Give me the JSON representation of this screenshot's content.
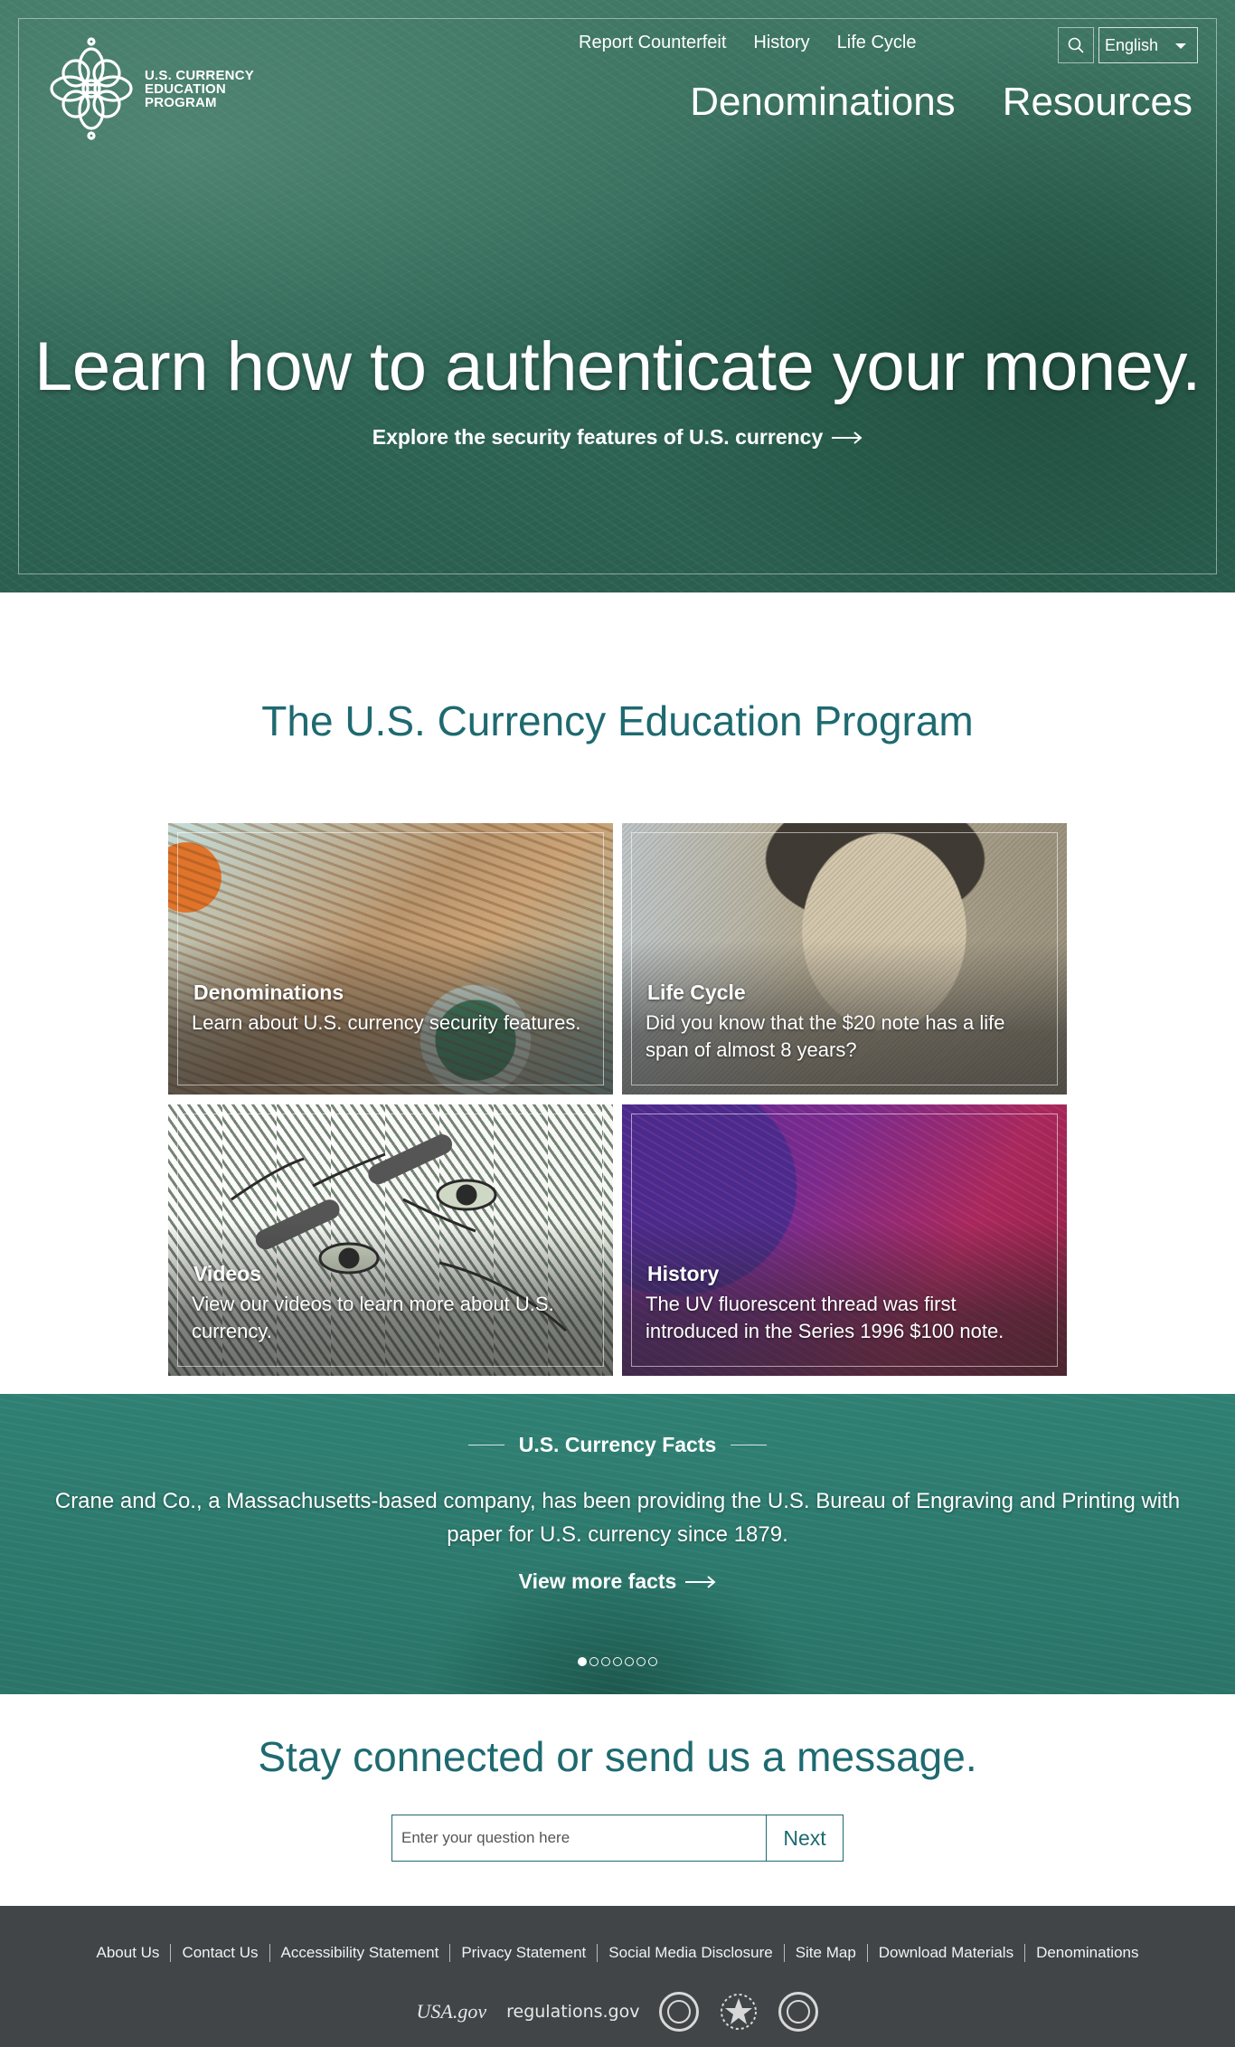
{
  "header": {
    "logo_lines": [
      "U.S. CURRENCY",
      "EDUCATION",
      "PROGRAM"
    ],
    "utility_nav": [
      "Report Counterfeit",
      "History",
      "Life Cycle"
    ],
    "language": "English",
    "main_nav": [
      "Denominations",
      "Resources"
    ]
  },
  "hero": {
    "heading": "Learn how to authenticate your money.",
    "cta": "Explore the security features of U.S. currency"
  },
  "program": {
    "title": "The U.S. Currency Education Program",
    "cards": [
      {
        "title": "Denominations",
        "description": "Learn about U.S. currency security features."
      },
      {
        "title": "Life Cycle",
        "description": "Did you know that the $20 note has a life span of almost 8 years?"
      },
      {
        "title": "Videos",
        "description": "View our videos to learn more about U.S. currency."
      },
      {
        "title": "History",
        "description": "The UV fluorescent thread was first introduced in the Series 1996 $100 note."
      }
    ]
  },
  "facts": {
    "heading": "U.S. Currency Facts",
    "text": "Crane and Co., a Massachusetts-based company, has been providing the U.S. Bureau of Engraving and Printing with paper for U.S. currency since 1879.",
    "cta": "View more facts",
    "slide_count": 7,
    "active_slide": 1
  },
  "contact": {
    "title": "Stay connected or send us a message.",
    "placeholder": "Enter your question here",
    "button": "Next"
  },
  "footer": {
    "links": [
      "About Us",
      "Contact Us",
      "Accessibility Statement",
      "Privacy Statement",
      "Social Media Disclosure",
      "Site Map",
      "Download Materials",
      "Denominations"
    ],
    "partners": {
      "usa": "USA.gov",
      "regulations": "regulations.gov"
    }
  }
}
